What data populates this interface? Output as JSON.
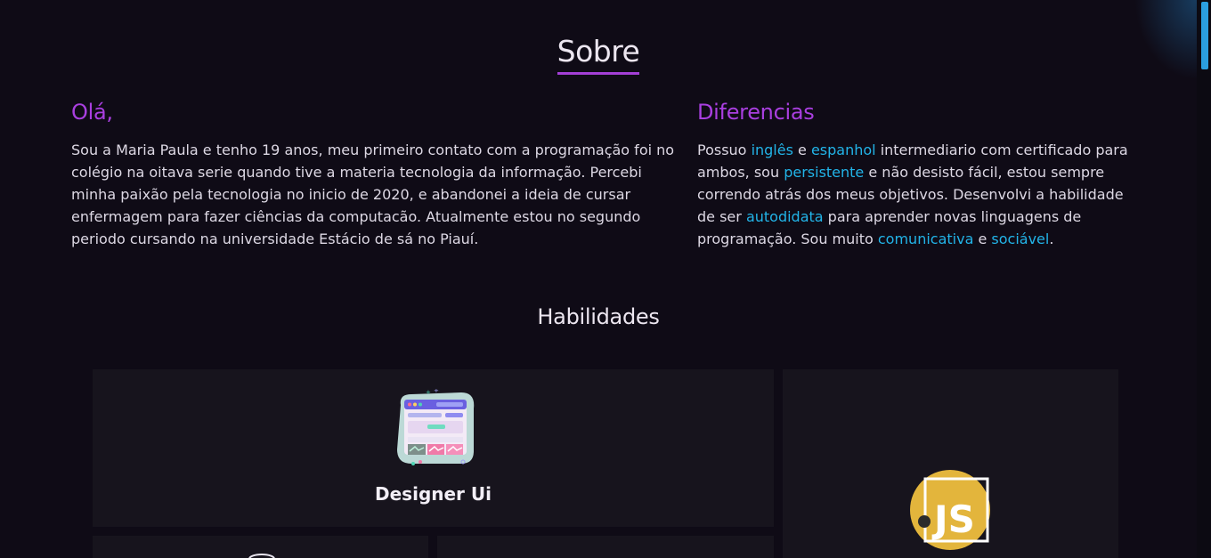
{
  "about": {
    "title": "Sobre",
    "greeting": {
      "heading": "Olá,",
      "text": "Sou a Maria Paula e tenho 19 anos, meu primeiro contato com a programação foi no colégio na oitava serie quando tive a materia tecnologia da informação. Percebi minha paixão pela tecnologia no inicio de 2020, e abandonei a ideia de cursar enfermagem para fazer ciências da computacão. Atualmente estou no segundo periodo cursando na universidade Estácio de sá no Piauí."
    },
    "differentials": {
      "heading": "Diferencias",
      "t1": "Possuo ",
      "h1": "inglês",
      "t2": " e ",
      "h2": "espanhol",
      "t3": " intermediario com certificado para ambos, sou ",
      "h3": "persistente",
      "t4": " e não desisto fácil, estou sempre correndo atrás dos meus objetivos. Desenvolvi a habilidade de ser ",
      "h4": "autodidata",
      "t5": " para aprender novas linguagens de programação. Sou muito ",
      "h5": "comunicativa",
      "t6": " e ",
      "h6": "sociável",
      "t7": "."
    }
  },
  "skills": {
    "title": "Habilidades",
    "cards": [
      {
        "label": "Designer Ui",
        "icon": "ui-design-icon"
      },
      {
        "label": "",
        "icon": "javascript-icon",
        "icon_text": "JS"
      }
    ]
  },
  "colors": {
    "background": "#0f0b16",
    "card": "#17141d",
    "accent_purple": "#a93fe0",
    "accent_blue": "#22b4e8",
    "js_yellow": "#e3b53c"
  }
}
